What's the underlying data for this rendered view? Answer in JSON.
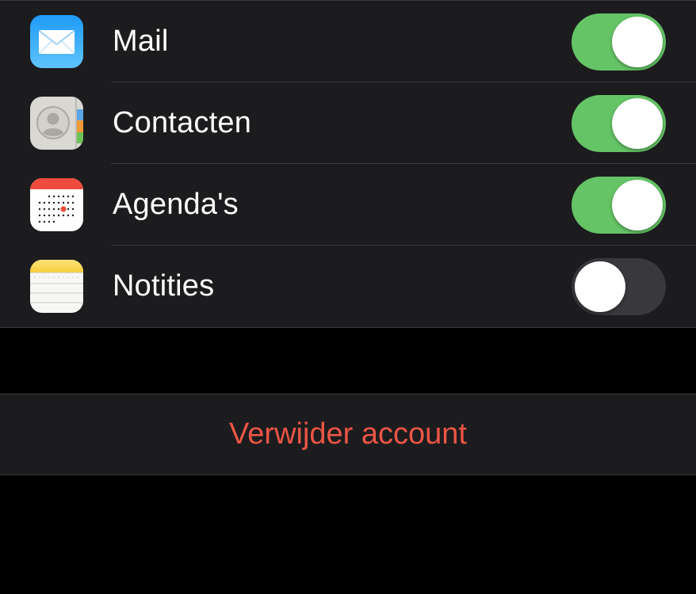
{
  "colors": {
    "group_background": "#1c1c1e",
    "separator": "#3a3a3c",
    "toggle_on": "#65c466",
    "toggle_off": "#39393d",
    "text": "#ffffff",
    "destructive": "#eb5545"
  },
  "sync_items": [
    {
      "label": "Mail",
      "icon": "mail-icon",
      "enabled": true
    },
    {
      "label": "Contacten",
      "icon": "contacts-icon",
      "enabled": true
    },
    {
      "label": "Agenda's",
      "icon": "calendar-icon",
      "enabled": true
    },
    {
      "label": "Notities",
      "icon": "notes-icon",
      "enabled": false
    }
  ],
  "delete_account": {
    "label": "Verwijder account"
  }
}
